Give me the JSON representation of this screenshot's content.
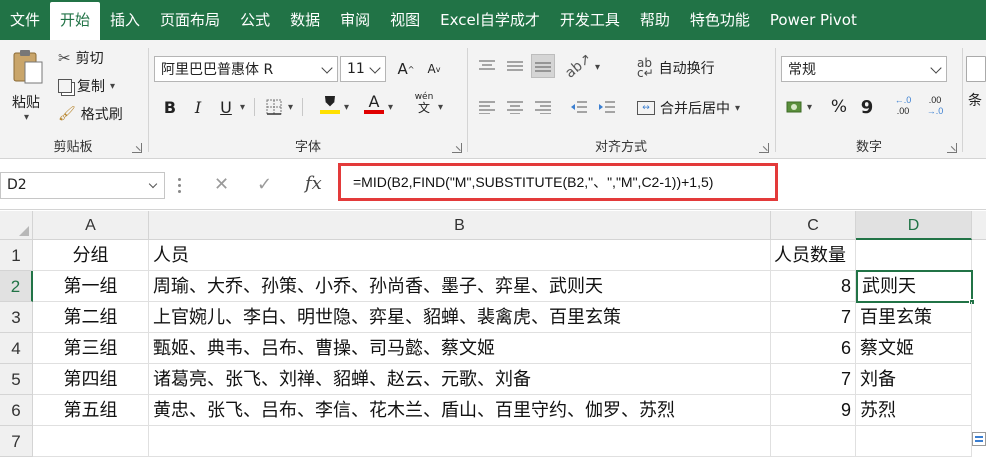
{
  "menu": {
    "tabs": [
      "文件",
      "开始",
      "插入",
      "页面布局",
      "公式",
      "数据",
      "审阅",
      "视图",
      "Excel自学成才",
      "开发工具",
      "帮助",
      "特色功能",
      "Power Pivot"
    ],
    "active_index": 1
  },
  "clipboard": {
    "paste": "粘贴",
    "cut": "剪切",
    "copy": "复制",
    "format_painter": "格式刷",
    "group_label": "剪贴板"
  },
  "font": {
    "name": "阿里巴巴普惠体 R",
    "size": "11",
    "bold": "B",
    "italic": "I",
    "underline": "U",
    "font_color_glyph": "A",
    "phonetic_top": "wén",
    "phonetic_bottom": "文",
    "group_label": "字体",
    "fill_color": "#ffe000",
    "font_color": "#e00000"
  },
  "alignment": {
    "wrap_text": "自动换行",
    "merge_center": "合并后居中",
    "group_label": "对齐方式"
  },
  "number": {
    "format": "常规",
    "percent": "%",
    "comma": "9",
    "inc_decimal_top": "←.0",
    "inc_decimal_bottom": ".00",
    "dec_decimal_top": ".00",
    "dec_decimal_bottom": "→.0",
    "group_label": "数字",
    "overflow_label": "条"
  },
  "formula_bar": {
    "name_box": "D2",
    "cancel": "✕",
    "enter": "✓",
    "fx": "fx",
    "formula": "=MID(B2,FIND(\"M\",SUBSTITUTE(B2,\"、\",\"M\",C2-1))+1,5)"
  },
  "sheet": {
    "columns": [
      "A",
      "B",
      "C",
      "D"
    ],
    "selected_column": "D",
    "rows": [
      {
        "num": "1",
        "A": "分组",
        "B": "人员",
        "C": "人员数量",
        "D": ""
      },
      {
        "num": "2",
        "A": "第一组",
        "B": "周瑜、大乔、孙策、小乔、孙尚香、墨子、弈星、武则天",
        "C": "8",
        "D": "武则天"
      },
      {
        "num": "3",
        "A": "第二组",
        "B": "上官婉儿、李白、明世隐、弈星、貂蝉、裴禽虎、百里玄策",
        "C": "7",
        "D": "百里玄策"
      },
      {
        "num": "4",
        "A": "第三组",
        "B": "甄姬、典韦、吕布、曹操、司马懿、蔡文姬",
        "C": "6",
        "D": "蔡文姬"
      },
      {
        "num": "5",
        "A": "第四组",
        "B": "诸葛亮、张飞、刘禅、貂蝉、赵云、元歌、刘备",
        "C": "7",
        "D": "刘备"
      },
      {
        "num": "6",
        "A": "第五组",
        "B": "黄忠、张飞、吕布、李信、花木兰、盾山、百里守约、伽罗、苏烈",
        "C": "9",
        "D": "苏烈"
      },
      {
        "num": "7",
        "A": "",
        "B": "",
        "C": "",
        "D": ""
      }
    ],
    "active_cell": "D2"
  }
}
